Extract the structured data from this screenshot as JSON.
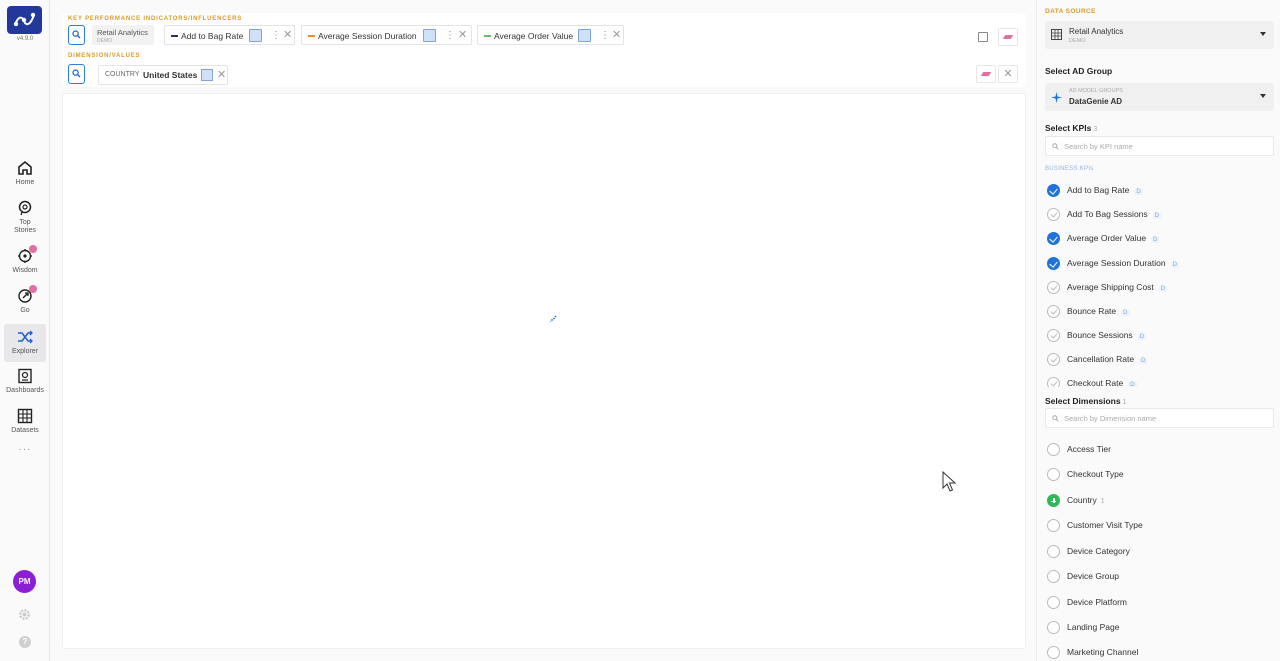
{
  "app": {
    "version": "v4.9.0"
  },
  "nav": {
    "items": [
      {
        "label": "Home",
        "icon": "home-icon"
      },
      {
        "label": "Top\nStories",
        "icon": "top-stories-icon"
      },
      {
        "label": "Wisdom",
        "icon": "wisdom-icon"
      },
      {
        "label": "Go",
        "icon": "go-icon"
      },
      {
        "label": "Explorer",
        "icon": "explorer-icon",
        "active": true
      },
      {
        "label": "Dashboards",
        "icon": "dashboards-icon"
      },
      {
        "label": "Datasets",
        "icon": "datasets-icon"
      }
    ],
    "more": "···",
    "avatar_initials": "PM",
    "help": "?"
  },
  "filters": {
    "kpi_section_title": "KEY PERFORMANCE INDICATORS/INFLUENCERS",
    "dimension_section_title": "DIMENSION/VALUES",
    "datasource_chip": {
      "name": "Retail Analytics",
      "tag": "DEMO"
    },
    "kpis": [
      {
        "label": "Add to Bag Rate",
        "color": "#2a3350"
      },
      {
        "label": "Average Session Duration",
        "color": "#e8902a"
      },
      {
        "label": "Average Order Value",
        "color": "#6dbb6a"
      }
    ],
    "dimension_chip": {
      "key": "COUNTRY",
      "value": "United States"
    }
  },
  "panel": {
    "data_source_title": "DATA SOURCE",
    "data_source": {
      "name": "Retail Analytics",
      "tag": "DEMO"
    },
    "ad_group_label": "Select AD Group",
    "ad_group": {
      "category": "AD MODEL GROUPS",
      "name": "DataGenie AD"
    },
    "kpis_label": "Select KPIs",
    "kpis_count": "3",
    "kpi_search_placeholder": "Search by KPI name",
    "business_kpis_label": "BUSINESS KPIs",
    "kpi_list": [
      {
        "name": "Add to Bag Rate",
        "tag": "D",
        "checked": true
      },
      {
        "name": "Add To Bag Sessions",
        "tag": "D",
        "checked": false
      },
      {
        "name": "Average Order Value",
        "tag": "D",
        "checked": true
      },
      {
        "name": "Average Session Duration",
        "tag": "D",
        "checked": true
      },
      {
        "name": "Average Shipping Cost",
        "tag": "D",
        "checked": false
      },
      {
        "name": "Bounce Rate",
        "tag": "D",
        "checked": false
      },
      {
        "name": "Bounce Sessions",
        "tag": "D",
        "checked": false
      },
      {
        "name": "Cancellation Rate",
        "tag": "D",
        "checked": false
      },
      {
        "name": "Checkout Rate",
        "tag": "D",
        "checked": false
      }
    ],
    "dimensions_label": "Select Dimensions",
    "dimensions_count": "1",
    "dimension_search_placeholder": "Search by Dimension name",
    "dimension_list": [
      {
        "name": "Access Tier",
        "count": ""
      },
      {
        "name": "Checkout Type",
        "count": ""
      },
      {
        "name": "Country",
        "count": "1",
        "selected": true
      },
      {
        "name": "Customer Visit Type",
        "count": ""
      },
      {
        "name": "Device Category",
        "count": ""
      },
      {
        "name": "Device Group",
        "count": ""
      },
      {
        "name": "Device Platform",
        "count": ""
      },
      {
        "name": "Landing Page",
        "count": ""
      },
      {
        "name": "Marketing Channel",
        "count": ""
      }
    ]
  }
}
